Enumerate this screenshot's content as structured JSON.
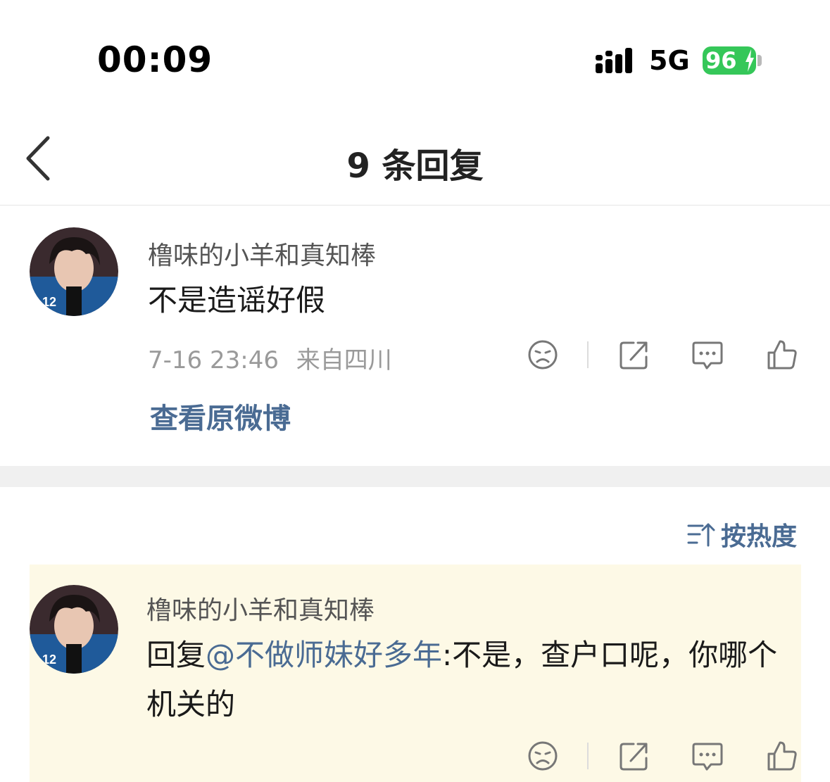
{
  "status_bar": {
    "time": "00:09",
    "network": "5G",
    "battery": "96",
    "battery_color": "#35c759"
  },
  "nav": {
    "title": "9 条回复",
    "back_icon": "chevron-left-icon"
  },
  "main_comment": {
    "username": "橹味的小羊和真知棒",
    "text": "不是造谣好假",
    "timestamp": "7-16 23:46",
    "location": "来自四川",
    "view_original": "查看原微博",
    "icons": [
      "sad-face-icon",
      "share-icon",
      "comment-icon",
      "like-icon"
    ]
  },
  "sort": {
    "label": "按热度",
    "icon": "sort-icon"
  },
  "replies": [
    {
      "username": "橹味的小羊和真知棒",
      "reply_prefix": "回复",
      "mention": "@不做师妹好多年",
      "text": ":不是，查户口呢，你哪个机关的",
      "icons": [
        "sad-face-icon",
        "share-icon",
        "comment-icon",
        "like-icon"
      ]
    }
  ],
  "colors": {
    "link": "#4a6b93",
    "highlight_bg": "#fdf9e6",
    "section_gap": "#f0f0f0"
  }
}
